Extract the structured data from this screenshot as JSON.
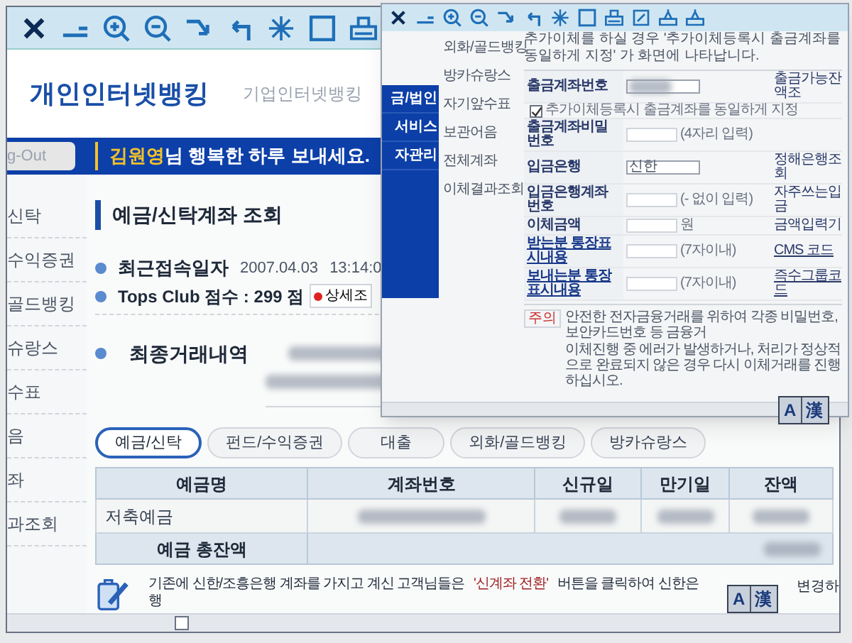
{
  "main_window": {
    "header": {
      "title": "개인인터넷뱅킹",
      "corporate_link": "기업인터넷뱅킹"
    },
    "logout_button": "g-Out",
    "greeting": {
      "name": "김원영",
      "message": "님 행복한 하루 보내세요."
    },
    "side_menu": [
      {
        "label": "신탁"
      },
      {
        "label": "수익증권"
      },
      {
        "label": "골드뱅킹"
      },
      {
        "label": "슈랑스"
      },
      {
        "label": "수표"
      },
      {
        "label": "음"
      },
      {
        "label": "좌"
      },
      {
        "label": "과조회"
      }
    ],
    "section_title": "예금/신탁계좌 조회",
    "last_login": {
      "label": "최근접속일자",
      "date": "2007.04.03",
      "time": "13:14:0"
    },
    "tops_club": {
      "label": "Tops Club 점수 : 299 점",
      "button": "상세조"
    },
    "recent_transactions": {
      "label": "최종거래내역"
    },
    "tabs": [
      {
        "label": "예금/신탁",
        "selected": true
      },
      {
        "label": "펀드/수익증권",
        "selected": false
      },
      {
        "label": "대출",
        "selected": false
      },
      {
        "label": "외화/골드뱅킹",
        "selected": false
      },
      {
        "label": "방카슈랑스",
        "selected": false
      }
    ],
    "table": {
      "columns": [
        "예금명",
        "계좌번호",
        "신규일",
        "만기일",
        "잔액"
      ],
      "rows": [
        {
          "cells": [
            "저축예금"
          ]
        }
      ],
      "total_label": "예금 총잔액"
    },
    "notice": {
      "before": "기존에 신한/조흥은행 계좌를 가지고 계신 고객님들은",
      "highlight": "'신계좌 전환'",
      "after": "버튼을 클릭하여 신한은행",
      "tail": "변경하"
    },
    "ime": {
      "latin": "A",
      "hanja": "漢"
    }
  },
  "transfer_window": {
    "nav": [
      {
        "label": "금/법인"
      },
      {
        "label": "서비스"
      },
      {
        "label": "자관리"
      }
    ],
    "submenu": [
      {
        "label": "외화/골드뱅킹"
      },
      {
        "label": "방카슈랑스"
      },
      {
        "label": "자기앞수표"
      },
      {
        "label": "보관어음"
      },
      {
        "label": "전체계좌"
      },
      {
        "label": "이체결과조회"
      }
    ],
    "info": "추가이체를 하실 경우 '추가이체등록시 출금계좌를 동일하게 지정' 가 화면에 나타납니다.",
    "rows": [
      {
        "label": "출금계좌번호",
        "link": false,
        "field": {
          "kind": "select"
        },
        "side": "출금가능잔액조",
        "option": {
          "label": "추가이체등록시 출금계좌를 동일하게 지정",
          "checked": true
        }
      },
      {
        "label": "출금계좌비밀번호",
        "link": false,
        "field": {
          "kind": "input",
          "note": "(4자리 입력)"
        }
      },
      {
        "label": "입금은행",
        "link": false,
        "field": {
          "kind": "select",
          "value": "신한"
        },
        "side": "정해은행조회"
      },
      {
        "label": "입금은행계좌번호",
        "link": false,
        "field": {
          "kind": "input",
          "note": "(- 없이 입력)"
        },
        "side": "자주쓰는입금"
      },
      {
        "label": "이체금액",
        "link": false,
        "field": {
          "kind": "input",
          "note": "원"
        },
        "side": "금액입력기"
      },
      {
        "label": "받는분 통장표시내용",
        "link": true,
        "field": {
          "kind": "input",
          "note": "(7자이내)"
        },
        "side": "CMS 코드"
      },
      {
        "label": "보내는분 통장표시내용",
        "link": true,
        "field": {
          "kind": "input",
          "note": "(7자이내)"
        },
        "side": "즉수그룹코드"
      }
    ],
    "warning": {
      "tag": "주의",
      "items": [
        "안전한 전자금융거래를 위하여 각종 비밀번호, 보안카드번호 등 금융거",
        "이체진행 중 에러가 발생하거나, 처리가 정상적으로 완료되지 않은 경우 다시 이체거래를 진행하십시오."
      ]
    },
    "ime": {
      "latin": "A",
      "hanja": "漢"
    }
  }
}
